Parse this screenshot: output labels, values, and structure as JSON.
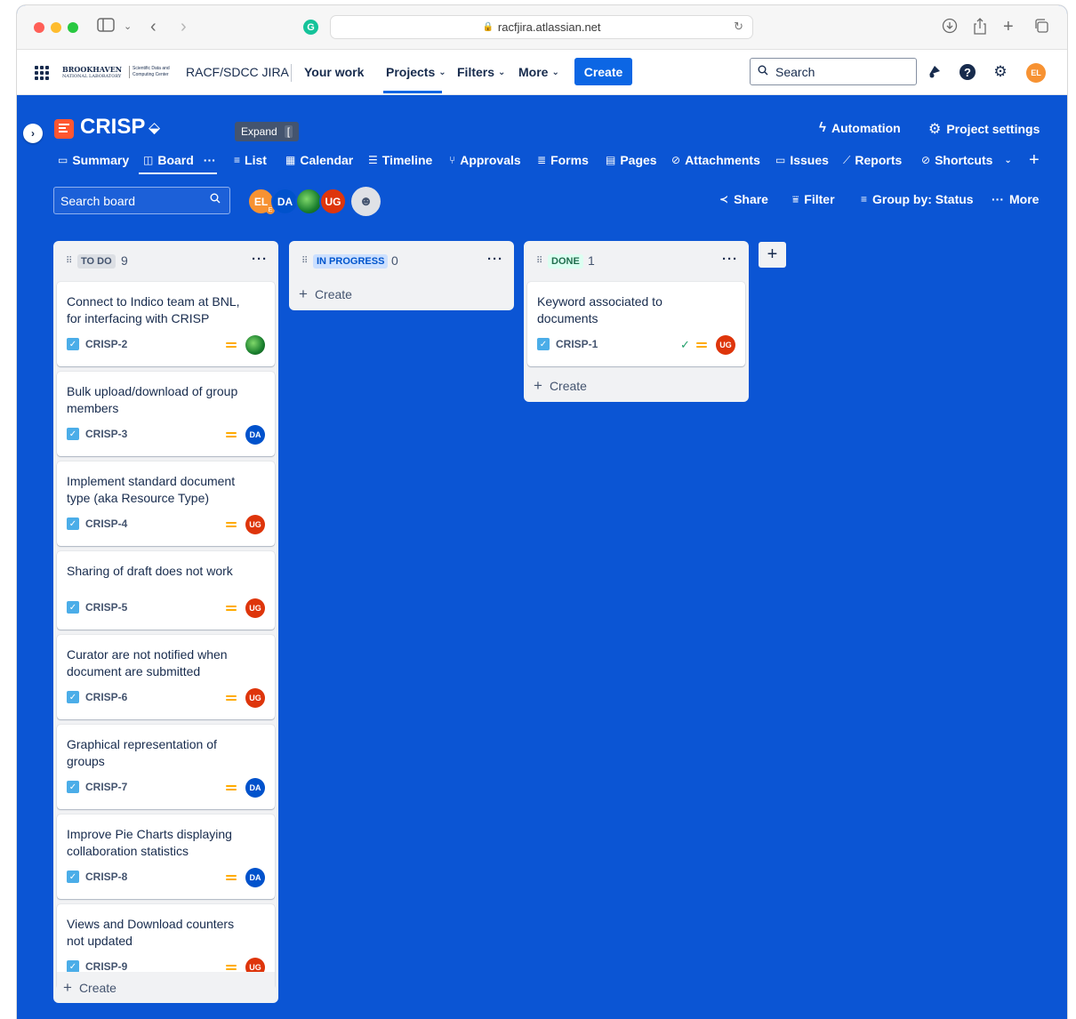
{
  "browser": {
    "url": "racfjira.atlassian.net",
    "grammarly_letter": "G"
  },
  "topnav": {
    "org_logo_line1": "BROOKHAVEN",
    "org_logo_line2": "NATIONAL LABORATORY",
    "org_logo_sub": "Scientific Data and Computing Center",
    "site_name": "RACF/SDCC JIRA",
    "menu": [
      "Your work",
      "Projects",
      "Filters",
      "More"
    ],
    "create_label": "Create",
    "search_placeholder": "Search",
    "user_initials": "EL"
  },
  "project": {
    "name": "CRISP",
    "tooltip_label": "Expand",
    "tooltip_key": "[",
    "automation_label": "Automation",
    "settings_label": "Project settings",
    "tabs": [
      {
        "label": "Summary",
        "icon": "summary-icon"
      },
      {
        "label": "Board",
        "icon": "board-icon"
      },
      {
        "label": "List",
        "icon": "list-icon"
      },
      {
        "label": "Calendar",
        "icon": "calendar-icon"
      },
      {
        "label": "Timeline",
        "icon": "timeline-icon"
      },
      {
        "label": "Approvals",
        "icon": "approvals-icon"
      },
      {
        "label": "Forms",
        "icon": "forms-icon"
      },
      {
        "label": "Pages",
        "icon": "pages-icon"
      },
      {
        "label": "Attachments",
        "icon": "attachments-icon"
      },
      {
        "label": "Issues",
        "icon": "issues-icon"
      },
      {
        "label": "Reports",
        "icon": "reports-icon"
      },
      {
        "label": "Shortcuts",
        "icon": "shortcuts-icon"
      }
    ]
  },
  "toolbar": {
    "search_placeholder": "Search board",
    "avatars": [
      "EL",
      "DA",
      "",
      "UG"
    ],
    "el_badge": "E",
    "share_label": "Share",
    "filter_label": "Filter",
    "group_by_label": "Group by: Status",
    "more_label": "More"
  },
  "columns": [
    {
      "status": "TO DO",
      "count": "9",
      "create_label": "Create",
      "cards": [
        {
          "title": "Connect to Indico team at BNL, for interfacing with CRISP",
          "key": "CRISP-2",
          "assignee": ""
        },
        {
          "title": "Bulk upload/download of group members",
          "key": "CRISP-3",
          "assignee": "DA"
        },
        {
          "title": "Implement standard document type (aka Resource Type)",
          "key": "CRISP-4",
          "assignee": "UG"
        },
        {
          "title": "Sharing of draft does not work",
          "key": "CRISP-5",
          "assignee": "UG"
        },
        {
          "title": "Curator are not notified when document are submitted",
          "key": "CRISP-6",
          "assignee": "UG"
        },
        {
          "title": "Graphical representation of groups",
          "key": "CRISP-7",
          "assignee": "DA"
        },
        {
          "title": "Improve Pie Charts displaying collaboration statistics",
          "key": "CRISP-8",
          "assignee": "DA"
        },
        {
          "title": "Views and Download counters not updated",
          "key": "CRISP-9",
          "assignee": "UG"
        }
      ]
    },
    {
      "status": "IN PROGRESS",
      "count": "0",
      "create_label": "Create",
      "cards": []
    },
    {
      "status": "DONE",
      "count": "1",
      "create_label": "Create",
      "cards": [
        {
          "title": "Keyword associated to documents",
          "key": "CRISP-1",
          "assignee": "UG"
        }
      ]
    }
  ],
  "colors": {
    "board_bg": "#0b55d4",
    "todo_lozenge": "#dcdfe4",
    "inprogress_lozenge": "#cce0ff",
    "done_lozenge": "#dcfff1",
    "avatar_el": "#f79232",
    "avatar_da": "#0052cc",
    "avatar_ug": "#de350b"
  }
}
